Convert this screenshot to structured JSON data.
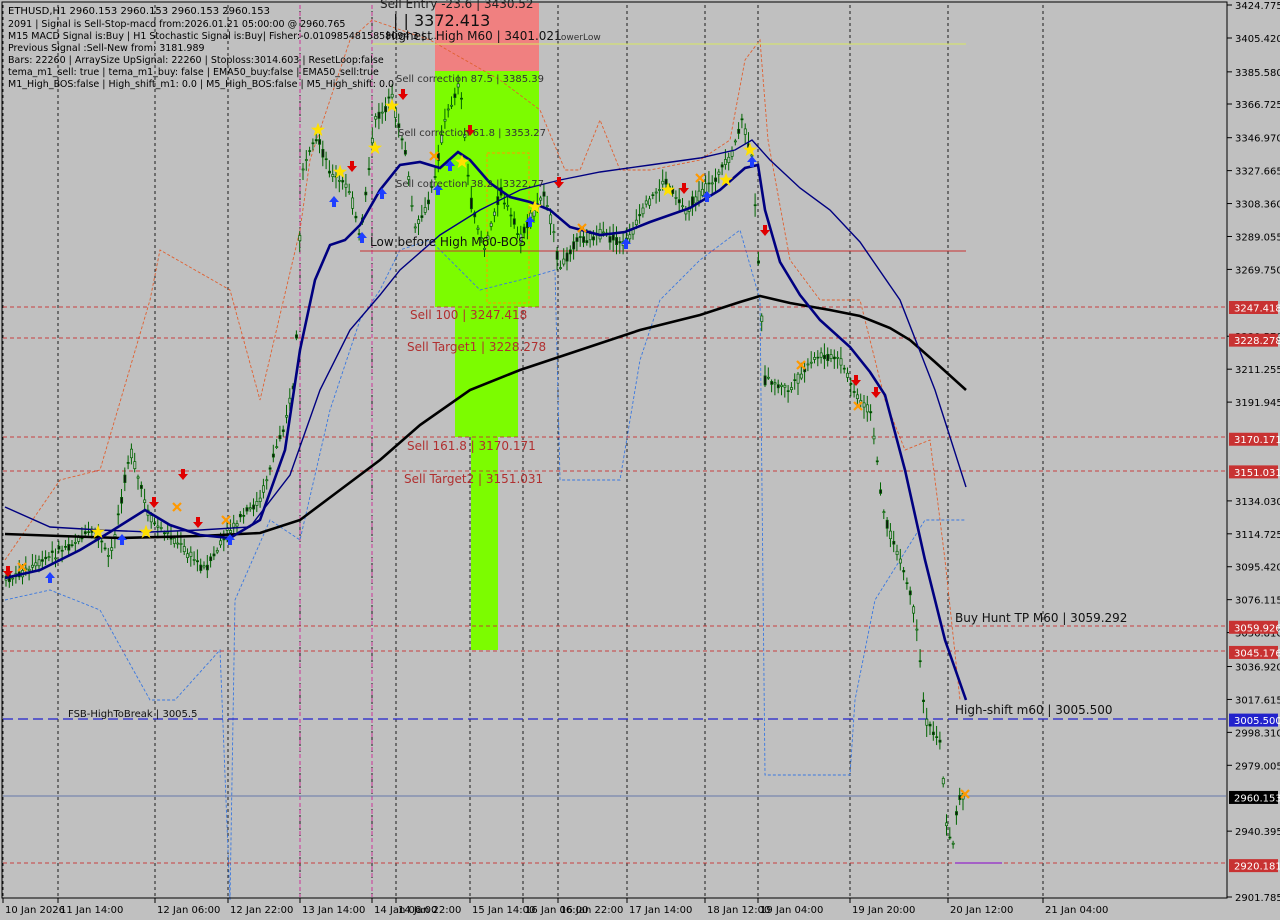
{
  "window": {
    "symbol_line": "ETHUSD,H1  2960.153 2960.153 2960.153 2960.153"
  },
  "info_lines": [
    "2091 | Signal is Sell-Stop-macd from:2026.01.21 05:00:00 @ 2960.765",
    "M15 MACD Signal is:Buy | H1 Stochastic Signal is:Buy| Fisher:-0.0109854815858094 3 | ...",
    "Previous Signal :Sell-New from: 3181.989",
    "Bars: 22260 | ArraySize UpSignal: 22260 | Stoploss:3014.603 | ResetLoop:false",
    "tema_m1_sell: true | tema_m1_buy: false | EMA50_buy:false | EMA50_sell:true",
    "M1_High_BOS:false | High_shift_m1: 0.0 | M5_High_BOS:false | M5_High_shift: 0.0"
  ],
  "price_axis": {
    "min": 2901.785,
    "max": 3424.775,
    "ticks": [
      3424.775,
      3405.42,
      3385.58,
      3366.725,
      3346.97,
      3327.665,
      3308.36,
      3289.055,
      3269.75,
      3230.57,
      3211.255,
      3191.945,
      3134.03,
      3114.725,
      3095.42,
      3076.115,
      3056.81,
      3036.92,
      3017.615,
      2998.31,
      2979.005,
      2940.395,
      2901.785
    ],
    "tick_labels": [
      "3424.775",
      "3405.420",
      "3385.580",
      "3366.725",
      "3346.970",
      "3327.665",
      "3308.360",
      "3289.055",
      "3269.750",
      "3230.570",
      "3211.255",
      "3191.945",
      "3134.030",
      "3114.725",
      "3095.420",
      "3076.115",
      "3056.810",
      "3036.920",
      "3017.615",
      "2998.310",
      "2979.005",
      "2940.395",
      "2901.785"
    ]
  },
  "time_axis": {
    "labels": [
      "10 Jan 2026",
      "11 Jan 14:00",
      "12 Jan 06:00",
      "12 Jan 22:00",
      "13 Jan 14:00",
      "14 Jan 06:00",
      "14 Jan 22:00",
      "15 Jan 14:00",
      "16 Jan 06:00",
      "16 Jan 22:00",
      "17 Jan 14:00",
      "18 Jan 12:00",
      "19 Jan 04:00",
      "19 Jan 20:00",
      "20 Jan 12:00",
      "21 Jan 04:00"
    ]
  },
  "price_markers": [
    {
      "label": "3247.418",
      "value": 3247.418,
      "color": "#c83232"
    },
    {
      "label": "3228.278",
      "value": 3228.278,
      "color": "#c83232"
    },
    {
      "label": "3170.171",
      "value": 3170.171,
      "color": "#c83232"
    },
    {
      "label": "3151.031",
      "value": 3151.031,
      "color": "#c83232"
    },
    {
      "label": "3059.926",
      "value": 3059.926,
      "color": "#c83232"
    },
    {
      "label": "3045.176",
      "value": 3045.176,
      "color": "#c83232"
    },
    {
      "label": "3005.500",
      "value": 3005.5,
      "color": "#2222cc"
    },
    {
      "label": "2960.153",
      "value": 2960.153,
      "color": "#000000"
    },
    {
      "label": "2920.181",
      "value": 2920.181,
      "color": "#c83232"
    }
  ],
  "annotations": {
    "sell_entry": "Sell Entry -23.6 | 3430.52",
    "entry_price": "| | 3372.413",
    "highest_high": "Highest High  M60 | 3401.021",
    "highest_high_suffix": "LowerLow",
    "sell_correction_1": "Sell correction 87.5 | 3385.39",
    "sell_correction_2": "Sell correction 61.8 | 3353.27",
    "sell_correction_3": "Sell correction 38.2 | 3322.77",
    "low_before_high": "Low before High   M60-BOS",
    "sell_100": "Sell 100 | 3247.418",
    "sell_target1": "Sell Target1 | 3228.278",
    "sell_161": "Sell 161.8 | 3170.171",
    "sell_target2": "Sell Target2 | 3151.031",
    "buy_hunt": "Buy Hunt TP M60 | 3059.292",
    "high_shift": "High-shift m60 | 3005.500",
    "fsb": "FSB-HighToBreak | 3005.5"
  },
  "colors": {
    "background": "#c0c0c0",
    "sell_red": "#c83232",
    "zone_red": "#f08080",
    "zone_green": "#7cfc00",
    "ema_navy": "#000080",
    "ema_black": "#000000",
    "candle_green": "#006400",
    "arrow_up": "#1f3fff",
    "arrow_down": "#e00000",
    "star": "#ffe000",
    "cross": "#ff9900"
  }
}
